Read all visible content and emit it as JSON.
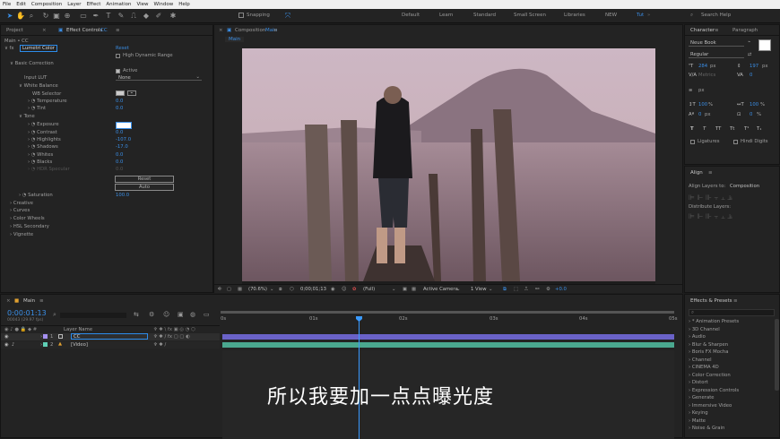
{
  "menu": [
    "File",
    "Edit",
    "Composition",
    "Layer",
    "Effect",
    "Animation",
    "View",
    "Window",
    "Help"
  ],
  "toolbar": {
    "snapping": "Snapping",
    "workspaces": [
      "Default",
      "Learn",
      "Standard",
      "Small Screen",
      "Libraries",
      "NEW",
      "Tut"
    ],
    "search_placeholder": "Search Help"
  },
  "project_panel": {
    "tab_project": "Project",
    "tab_effect": "Effect Controls",
    "effect_layer": "CC",
    "breadcrumb": "Main • CC",
    "fx_name": "Lumetri Color",
    "reset": "Reset",
    "hdr": "High Dynamic Range",
    "basic": "Basic Correction",
    "active": "Active",
    "input_lut_label": "Input LUT",
    "input_lut_val": "None",
    "wb": "White Balance",
    "wb_selector": "WB Selector",
    "temp_label": "Temperature",
    "temp_val": "0.0",
    "tint_label": "Tint",
    "tint_val": "0.0",
    "tone": "Tone",
    "tone_rows": [
      {
        "label": "Exposure",
        "value": ""
      },
      {
        "label": "Contrast",
        "value": "0.0"
      },
      {
        "label": "Highlights",
        "value": "-107.0"
      },
      {
        "label": "Shadows",
        "value": "-17.0"
      },
      {
        "label": "Whites",
        "value": "0.0"
      },
      {
        "label": "Blacks",
        "value": "0.0"
      }
    ],
    "hdr_spec": "HDR Specular",
    "hdr_spec_val": "0.0",
    "btn_reset": "Reset",
    "btn_auto": "Auto",
    "sat_label": "Saturation",
    "sat_val": "100.0",
    "sections": [
      "Creative",
      "Curves",
      "Color Wheels",
      "HSL Secondary",
      "Vignette"
    ]
  },
  "composition": {
    "tab_label": "Composition",
    "tab_name": "Main",
    "sub_tab": "Main",
    "zoom": "(70.6%)",
    "timecode": "0;00;01;13",
    "resolution": "(Full)",
    "camera": "Active Camera",
    "views": "1 View",
    "exposure": "+0.0"
  },
  "character": {
    "tab1": "Character",
    "tab2": "Paragraph",
    "font": "Neue Book",
    "style": "Regular",
    "size": "284",
    "size_unit": "px",
    "leading": "197",
    "leading_unit": "px",
    "kerning": "Metrics",
    "tracking": "0",
    "stroke": "px",
    "vscale": "100",
    "vscale_unit": "%",
    "hscale": "100",
    "hscale_unit": "%",
    "baseline": "0",
    "baseline_unit": "px",
    "tsume": "0",
    "tsume_unit": "%",
    "ligatures": "Ligatures",
    "hindi": "Hindi Digits",
    "text_styles": [
      "T",
      "T",
      "TT",
      "Tt",
      "T¹",
      "T₁"
    ]
  },
  "align": {
    "title": "Align",
    "to_label": "Align Layers to:",
    "to_val": "Composition",
    "distribute": "Distribute Layers:"
  },
  "effects": {
    "title": "Effects & Presets",
    "search_placeholder": "",
    "items": [
      "* Animation Presets",
      "3D Channel",
      "Audio",
      "Blur & Sharpen",
      "Boris FX Mocha",
      "Channel",
      "CINEMA 4D",
      "Color Correction",
      "Distort",
      "Expression Controls",
      "Generate",
      "Immersive Video",
      "Keying",
      "Matte",
      "Noise & Grain"
    ]
  },
  "timeline": {
    "tab": "Main",
    "timecode": "0:00:01:13",
    "fps": "00043 (29.97 fps)",
    "col_layer": "Layer Name",
    "layers": [
      {
        "num": "1",
        "name": "CC",
        "color": "#a590f0"
      },
      {
        "num": "2",
        "name": "[Video]",
        "color": "#5fcfb6"
      }
    ],
    "ruler": [
      "0s",
      "01s",
      "02s",
      "03s",
      "04s",
      "05s"
    ]
  },
  "caption": "所以我要加一点点曝光度",
  "colors": {
    "accent": "#3a8ee6",
    "panel": "#232323",
    "bg": "#1d1d1d",
    "bar_cc": "#6a62c8",
    "bar_video": "#4aa88f",
    "playhead": "#3a9aff"
  }
}
